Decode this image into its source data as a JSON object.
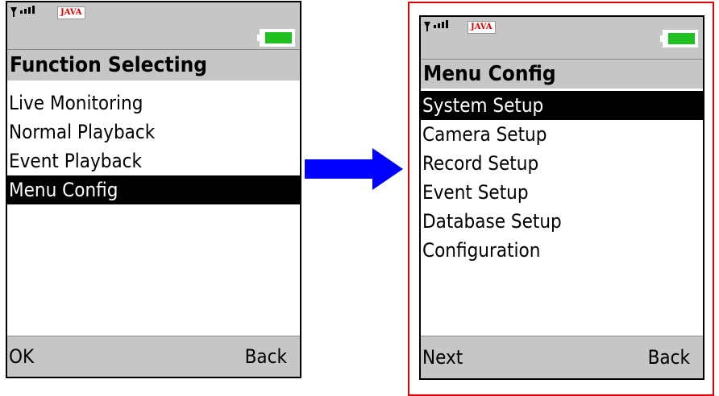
{
  "left_screen": {
    "status": {
      "java_logo": "JAVA",
      "signal_icon": "signal-strength-icon",
      "battery_icon": "battery-full-icon"
    },
    "title": "Function Selecting",
    "items": [
      "Live Monitoring",
      "Normal Playback",
      "Event Playback",
      "Menu Config"
    ],
    "selected_index": 3,
    "softkeys": {
      "left": "OK",
      "right": "Back"
    }
  },
  "arrow": {
    "icon": "arrow-right-icon",
    "color": "#0000ff"
  },
  "right_screen": {
    "status": {
      "java_logo": "JAVA",
      "signal_icon": "signal-strength-icon",
      "battery_icon": "battery-full-icon"
    },
    "title": "Menu Config",
    "items": [
      "System Setup",
      "Camera Setup",
      "Record Setup",
      "Event Setup",
      "Database Setup",
      "Configuration"
    ],
    "selected_index": 0,
    "softkeys": {
      "left": "Next",
      "right": "Back"
    }
  },
  "colors": {
    "bar": "#c6c6c6",
    "selected_bg": "#000000",
    "highlight_frame": "#e00000",
    "battery": "#20c020"
  }
}
